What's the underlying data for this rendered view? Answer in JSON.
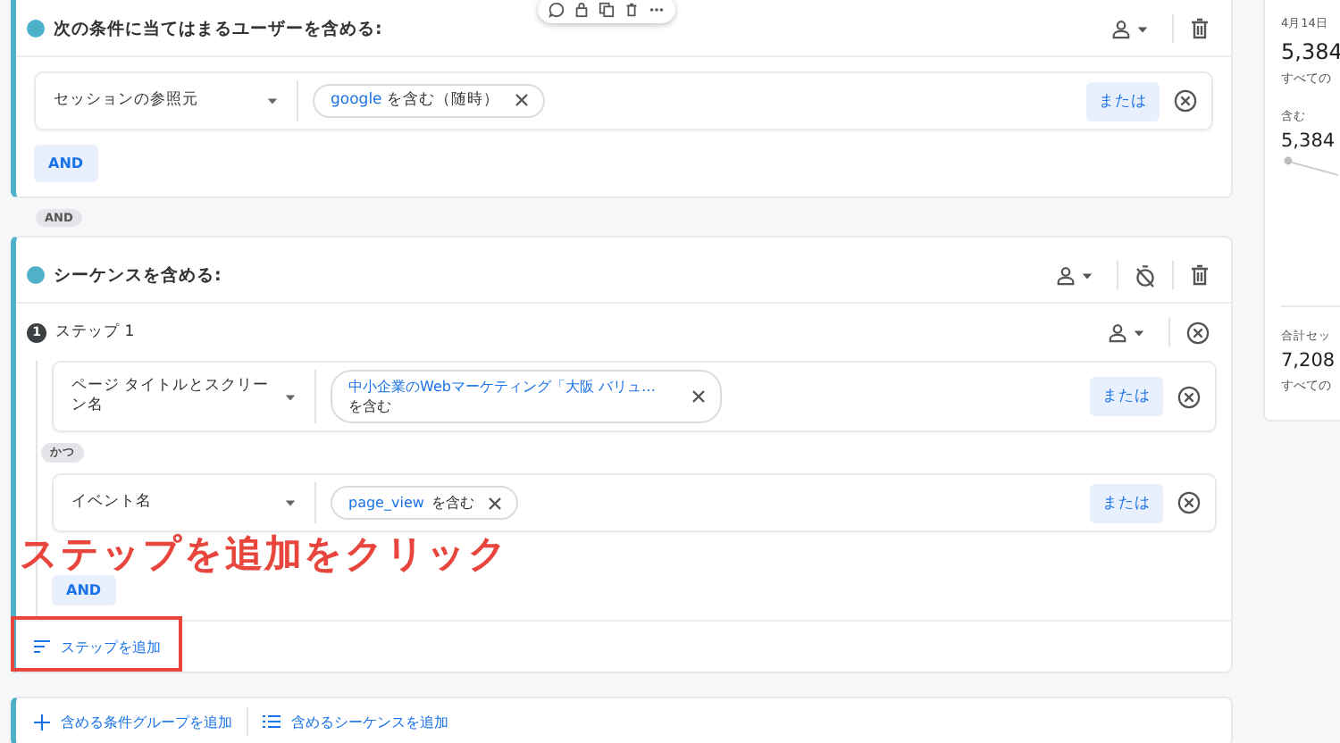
{
  "group_card": {
    "title": "次の条件に当てはまるユーザーを含める:",
    "conditions": [
      {
        "field": "セッションの参照元",
        "chips": [
          {
            "value": "google",
            "operator": "を含む（随時）"
          }
        ],
        "or_button": "または"
      }
    ],
    "and_button": "AND"
  },
  "connector": "AND",
  "sequence_card": {
    "title": "シーケンスを含める:",
    "steps": [
      {
        "number": "1",
        "label": "ステップ 1",
        "joiner": "かつ",
        "and_button": "AND",
        "conditions": [
          {
            "field": "ページ タイトルとスクリーン名",
            "chips": [
              {
                "value": "中小企業のWebマーケティング「大阪 バリュ…",
                "operator": "を含む"
              }
            ],
            "or_button": "または"
          },
          {
            "field": "イベント名",
            "chips": [
              {
                "value": "page_view",
                "operator": "を含む"
              }
            ],
            "or_button": "または"
          }
        ]
      }
    ],
    "add_step": "ステップを追加"
  },
  "footer": {
    "actions": [
      {
        "kind": "add",
        "label": "含める条件グループを追加"
      },
      {
        "kind": "list",
        "label": "含めるシーケンスを追加"
      }
    ]
  },
  "side_panel": {
    "date": "4月14日",
    "metrics": [
      {
        "value": "5,384",
        "caption": "すべての"
      }
    ],
    "series": {
      "label": "含む",
      "value": "5,384"
    },
    "total": {
      "label": "合計セッ",
      "value": "7,208",
      "caption": "すべての"
    }
  },
  "annotation": "ステップを追加をクリック"
}
